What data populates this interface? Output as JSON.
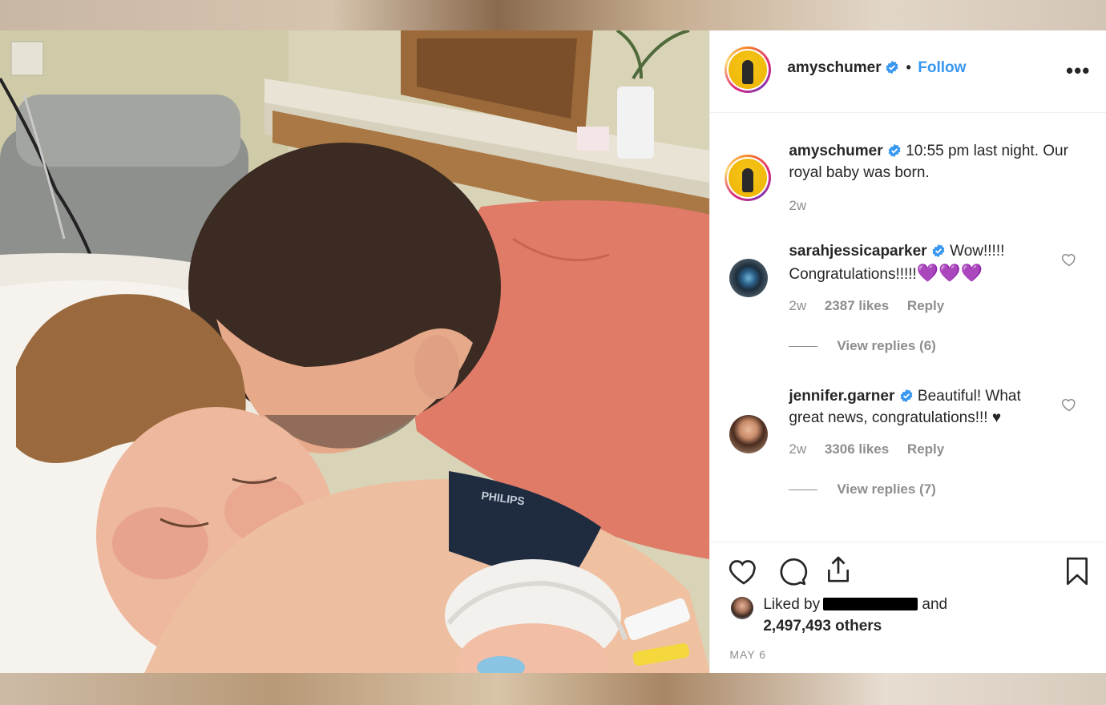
{
  "header": {
    "username": "amyschumer",
    "separator": "•",
    "follow_label": "Follow",
    "more_label": "•••"
  },
  "caption": {
    "username": "amyschumer",
    "text": "10:55 pm last night. Our royal baby was born.",
    "age": "2w"
  },
  "comments": [
    {
      "username": "sarahjessicaparker",
      "text": "Wow!!!!! Congratulations!!!!!",
      "emoji": "💜💜💜",
      "age": "2w",
      "likes": "2387 likes",
      "reply_label": "Reply",
      "view_replies": "View replies (6)"
    },
    {
      "username": "jennifer.garner",
      "text": "Beautiful! What great news, congratulations!!! ♥",
      "age": "2w",
      "likes": "3306 likes",
      "reply_label": "Reply",
      "view_replies": "View replies (7)"
    }
  ],
  "likes": {
    "prefix": "Liked by",
    "suffix": "and",
    "count_text": "2,497,493 others"
  },
  "post_date": "MAY 6",
  "icons": {
    "like": "heart-icon",
    "comment": "comment-icon",
    "share": "share-icon",
    "save": "bookmark-icon",
    "verified": "verified-badge-icon"
  },
  "colors": {
    "accent": "#3897f0",
    "text": "#262626",
    "secondary": "#8e8e8e",
    "border": "#efefef"
  }
}
